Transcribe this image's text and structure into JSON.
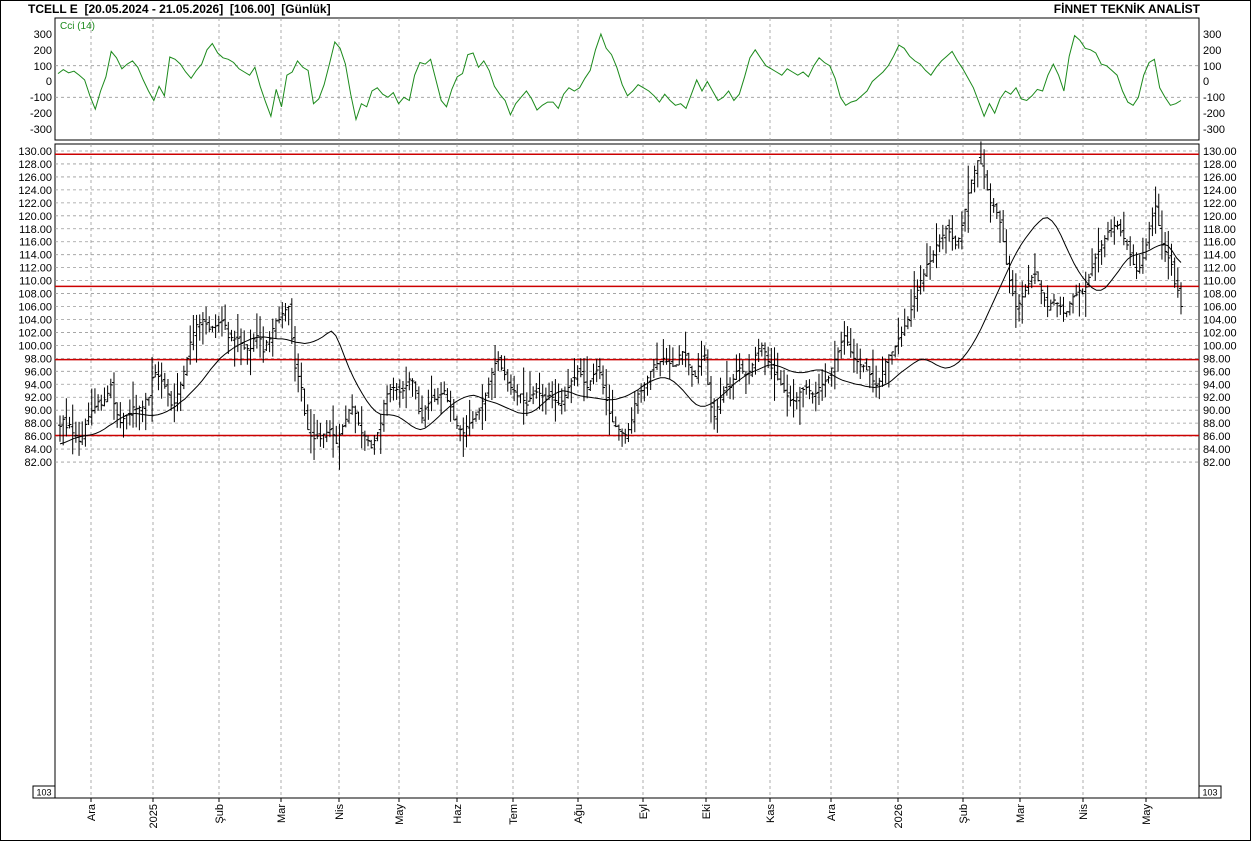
{
  "header": {
    "symbol": "TCELL E",
    "range": "[20.05.2024 - 21.05.2026]",
    "last": "[106.00]",
    "period": "[Günlük]",
    "vendor": "FİNNET TEKNİK ANALİST"
  },
  "colors": {
    "cci_line": "#1c8a1c",
    "price_bars": "#000000",
    "moving_average": "#000000",
    "support_resistance": "#cc0000",
    "grid": "#9a9a9a",
    "border": "#000000"
  },
  "chart_data": [
    {
      "type": "line",
      "title": "Cci (14)",
      "ylim": [
        -350,
        350
      ],
      "y_ticks": [
        "300",
        "200",
        "100",
        "0",
        "-100",
        "-200",
        "-300"
      ],
      "reference_lines": [
        100,
        -100
      ],
      "grid": true,
      "series": [
        {
          "name": "Cci (14)",
          "values": [
            50,
            75,
            55,
            65,
            40,
            10,
            -90,
            -175,
            -60,
            30,
            190,
            150,
            80,
            110,
            130,
            90,
            10,
            -60,
            -120,
            -30,
            -90,
            155,
            140,
            110,
            60,
            20,
            70,
            110,
            200,
            240,
            180,
            150,
            140,
            120,
            80,
            60,
            40,
            90,
            -30,
            -130,
            -220,
            -50,
            -160,
            40,
            60,
            130,
            90,
            70,
            -140,
            -110,
            -20,
            110,
            250,
            210,
            110,
            -80,
            -240,
            -140,
            -160,
            -60,
            -40,
            -80,
            -100,
            -70,
            -140,
            -100,
            -120,
            40,
            120,
            110,
            140,
            10,
            -120,
            -160,
            -50,
            30,
            50,
            170,
            180,
            90,
            130,
            70,
            -30,
            -80,
            -120,
            -210,
            -140,
            -100,
            -60,
            -110,
            -180,
            -150,
            -130,
            -130,
            -170,
            -80,
            -40,
            -60,
            -40,
            20,
            70,
            200,
            300,
            210,
            170,
            90,
            -20,
            -90,
            -60,
            -20,
            -40,
            -60,
            -90,
            -130,
            -80,
            -120,
            -150,
            -140,
            -170,
            -80,
            10,
            -60,
            0,
            -60,
            -120,
            -100,
            -60,
            -120,
            -80,
            30,
            150,
            200,
            150,
            100,
            80,
            60,
            40,
            80,
            60,
            40,
            60,
            30,
            100,
            150,
            120,
            100,
            20,
            -100,
            -150,
            -130,
            -120,
            -90,
            -60,
            0,
            30,
            60,
            100,
            160,
            230,
            210,
            160,
            130,
            110,
            70,
            40,
            90,
            130,
            160,
            190,
            130,
            80,
            20,
            -40,
            -130,
            -220,
            -140,
            -200,
            -110,
            -60,
            -80,
            -40,
            -110,
            -120,
            -90,
            -50,
            -60,
            40,
            110,
            40,
            -60,
            160,
            290,
            260,
            210,
            200,
            180,
            110,
            100,
            70,
            40,
            -60,
            -130,
            -150,
            -100,
            40,
            120,
            140,
            -40,
            -100,
            -150,
            -140,
            -120
          ]
        }
      ]
    },
    {
      "type": "bar",
      "subtype": "ohlc",
      "ylim": [
        81,
        130
      ],
      "y_ticks": [
        "130.00",
        "128.00",
        "126.00",
        "124.00",
        "122.00",
        "120.00",
        "118.00",
        "116.00",
        "114.00",
        "112.00",
        "110.00",
        "108.00",
        "106.00",
        "104.00",
        "102.00",
        "100.00",
        "98.00",
        "96.00",
        "94.00",
        "92.00",
        "90.00",
        "88.00",
        "86.00",
        "84.00",
        "82.00"
      ],
      "x_ticks": [
        "Ara",
        "2025",
        "Şub",
        "Mar",
        "Nis",
        "May",
        "Haz",
        "Tem",
        "Ağu",
        "Eyl",
        "Eki",
        "Kas",
        "Ara",
        "2026",
        "Şub",
        "Mar",
        "Nis",
        "May"
      ],
      "unit_label": "10^3",
      "horizontal_lines": [
        129.5,
        109.1,
        97.8,
        86.1
      ],
      "grid": true,
      "close": [
        87.5,
        88.6,
        87.3,
        87.8,
        86.5,
        86.1,
        85.2,
        86.0,
        87.8,
        89.0,
        89.9,
        90.5,
        91.3,
        90.8,
        91.6,
        92.6,
        93.9,
        91.0,
        89.3,
        88.1,
        88.7,
        89.3,
        89.5,
        90.5,
        90.2,
        90.4,
        90.5,
        91.7,
        92.0,
        95.0,
        95.8,
        95.2,
        94.5,
        93.7,
        92.5,
        90.8,
        91.1,
        92.5,
        94.0,
        96.0,
        98.0,
        100.5,
        102.0,
        103.2,
        103.5,
        104.0,
        103.3,
        102.5,
        102.8,
        103.0,
        103.5,
        103.8,
        103.1,
        101.2,
        101.2,
        101.0,
        101.1,
        100.3,
        99.6,
        99.5,
        99.5,
        101.0,
        101.5,
        101.0,
        99.0,
        100.5,
        101.0,
        102.6,
        103.8,
        104.0,
        104.9,
        105.5,
        106.0,
        101.0,
        96.5,
        95.2,
        93.5,
        89.5,
        87.0,
        86.0,
        85.6,
        86.0,
        85.6,
        86.3,
        86.6,
        87.0,
        86.2,
        84.9,
        86.2,
        87.5,
        88.6,
        90.0,
        90.5,
        89.5,
        88.0,
        86.5,
        86.0,
        85.3,
        84.2,
        85.3,
        86.5,
        88.0,
        91.0,
        92.5,
        93.2,
        93.5,
        93.2,
        92.8,
        93.0,
        93.8,
        94.8,
        94.5,
        93.0,
        89.8,
        88.8,
        90.2,
        91.0,
        92.0,
        91.7,
        92.0,
        92.5,
        93.0,
        91.5,
        90.5,
        88.5,
        87.6,
        87.0,
        86.5,
        87.5,
        88.0,
        88.6,
        89.3,
        90.0,
        91.4,
        92.3,
        94.0,
        95.8,
        97.2,
        97.8,
        96.5,
        95.5,
        94.2,
        93.5,
        93.0,
        92.2,
        92.5,
        91.5,
        90.8,
        91.8,
        92.5,
        92.8,
        92.6,
        92.2,
        91.7,
        92.3,
        92.0,
        91.5,
        91.0,
        91.4,
        92.3,
        93.5,
        94.5,
        95.0,
        96.0,
        95.5,
        94.3,
        93.5,
        94.5,
        95.5,
        96.2,
        95.8,
        93.5,
        91.5,
        89.5,
        88.2,
        87.5,
        87.0,
        86.5,
        86.2,
        87.0,
        88.5,
        91.0,
        92.5,
        93.0,
        94.0,
        95.0,
        96.0,
        97.0,
        97.2,
        97.5,
        98.0,
        97.5,
        97.2,
        96.8,
        97.0,
        98.5,
        99.0,
        98.5,
        97.0,
        95.5,
        95.2,
        96.8,
        97.8,
        98.5,
        94.0,
        90.5,
        89.0,
        90.5,
        92.0,
        93.0,
        94.0,
        93.5,
        94.8,
        96.0,
        96.5,
        96.0,
        95.5,
        96.0,
        97.0,
        98.5,
        99.5,
        100.0,
        99.0,
        97.5,
        96.5,
        95.5,
        94.8,
        94.0,
        93.0,
        92.2,
        91.5,
        91.5,
        92.0,
        92.8,
        93.2,
        93.5,
        93.0,
        92.5,
        92.6,
        93.5,
        94.0,
        94.5,
        95.0,
        96.5,
        97.8,
        99.0,
        100.5,
        101.5,
        100.5,
        99.0,
        98.0,
        97.5,
        97.0,
        96.8,
        96.2,
        95.5,
        94.5,
        93.8,
        94.5,
        96.0,
        97.5,
        98.5,
        99.0,
        99.8,
        101.0,
        102.0,
        103.0,
        104.0,
        105.5,
        107.5,
        108.5,
        110.0,
        111.0,
        112.5,
        113.0,
        114.0,
        115.5,
        116.0,
        117.0,
        118.0,
        117.5,
        116.5,
        115.5,
        116.5,
        118.5,
        121.0,
        123.5,
        125.5,
        127.0,
        128.5,
        128.0,
        126.0,
        124.0,
        122.0,
        121.5,
        120.5,
        119.0,
        116.0,
        112.5,
        110.0,
        108.0,
        106.0,
        106.5,
        107.5,
        108.5,
        109.5,
        110.5,
        111.0,
        110.0,
        108.5,
        107.0,
        106.0,
        106.5,
        107.0,
        106.5,
        106.0,
        105.0,
        105.2,
        106.5,
        107.5,
        107.8,
        108.5,
        108.0,
        109.0,
        110.5,
        112.0,
        113.5,
        114.5,
        115.5,
        116.5,
        117.5,
        118.0,
        118.5,
        118.5,
        117.5,
        116.5,
        115.5,
        114.0,
        112.5,
        111.5,
        112.0,
        113.5,
        115.5,
        118.0,
        120.0,
        121.5,
        118.5,
        115.5,
        114.5,
        113.5,
        112.5,
        109.5,
        108.5,
        106.0
      ],
      "moving_average": [
        84.8,
        85.0,
        85.3,
        85.6,
        85.8,
        86.0,
        86.1,
        86.2,
        86.4,
        86.7,
        87.1,
        87.6,
        88.0,
        88.5,
        88.9,
        89.2,
        89.4,
        89.5,
        89.4,
        89.3,
        89.2,
        89.2,
        89.3,
        89.5,
        89.8,
        90.2,
        90.6,
        91.2,
        91.7,
        92.4,
        93.1,
        93.8,
        94.6,
        95.5,
        96.4,
        97.2,
        98.0,
        98.6,
        99.1,
        99.6,
        100.0,
        100.4,
        100.7,
        101.0,
        101.2,
        101.3,
        101.3,
        101.2,
        101.1,
        101.0,
        101.0,
        100.9,
        100.7,
        100.5,
        100.4,
        100.3,
        100.4,
        100.6,
        100.9,
        101.3,
        101.8,
        102.2,
        101.5,
        100.0,
        98.2,
        96.5,
        95.0,
        93.7,
        92.5,
        91.4,
        90.5,
        89.8,
        89.4,
        89.3,
        89.3,
        89.2,
        89.0,
        88.6,
        88.1,
        87.6,
        87.2,
        87.0,
        87.2,
        87.7,
        88.3,
        88.9,
        89.6,
        90.2,
        90.8,
        91.3,
        91.7,
        92.0,
        92.2,
        92.3,
        92.1,
        91.8,
        91.5,
        91.3,
        91.1,
        90.8,
        90.5,
        90.2,
        89.9,
        89.6,
        89.5,
        89.5,
        89.7,
        90.1,
        90.7,
        91.3,
        91.9,
        92.4,
        92.8,
        93.0,
        92.9,
        92.7,
        92.4,
        92.2,
        92.1,
        92.0,
        91.9,
        91.8,
        91.7,
        91.6,
        91.6,
        91.7,
        91.9,
        92.1,
        92.4,
        92.8,
        93.2,
        93.7,
        94.1,
        94.5,
        94.8,
        95.0,
        95.0,
        94.8,
        94.4,
        93.8,
        93.1,
        92.3,
        91.5,
        90.9,
        90.6,
        90.6,
        90.9,
        91.3,
        91.8,
        92.4,
        93.0,
        93.7,
        94.3,
        94.8,
        95.3,
        95.7,
        96.0,
        96.3,
        96.6,
        96.9,
        97.0,
        96.9,
        96.7,
        96.4,
        96.1,
        95.9,
        95.8,
        95.8,
        95.9,
        96.1,
        96.2,
        96.2,
        96.0,
        95.7,
        95.3,
        94.9,
        94.6,
        94.4,
        94.2,
        94.0,
        93.9,
        93.7,
        93.6,
        93.5,
        93.6,
        93.8,
        94.1,
        94.6,
        95.2,
        95.8,
        96.3,
        96.8,
        97.3,
        97.7,
        97.9,
        97.7,
        97.4,
        97.0,
        96.7,
        96.5,
        96.6,
        96.9,
        97.4,
        98.1,
        99.0,
        100.0,
        101.2,
        102.5,
        104.0,
        105.5,
        107.0,
        108.5,
        110.0,
        111.5,
        113.0,
        114.3,
        115.5,
        116.5,
        117.4,
        118.3,
        119.0,
        119.6,
        119.7,
        119.2,
        118.3,
        117.0,
        115.5,
        114.0,
        112.6,
        111.4,
        110.4,
        109.6,
        108.9,
        108.5,
        108.5,
        108.9,
        109.7,
        110.6,
        111.5,
        112.5,
        113.3,
        113.8,
        114.0,
        114.2,
        114.4,
        114.7,
        115.1,
        115.4,
        115.6,
        115.4,
        114.6,
        113.5,
        112.8
      ]
    }
  ]
}
